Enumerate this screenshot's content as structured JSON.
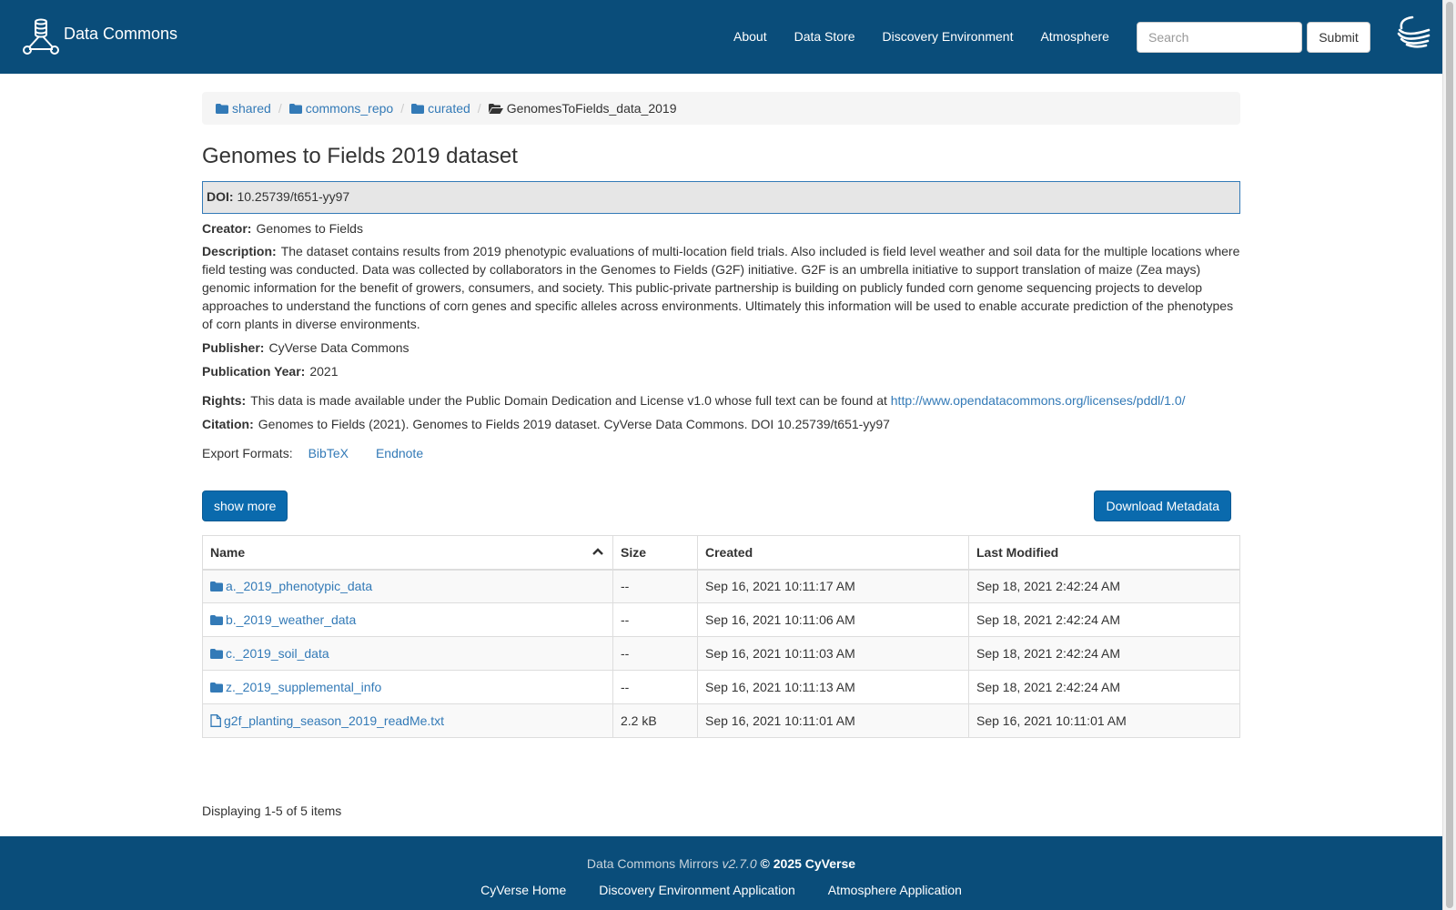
{
  "header": {
    "brand_name": "Data Commons",
    "nav": [
      "About",
      "Data Store",
      "Discovery Environment",
      "Atmosphere"
    ],
    "search_placeholder": "Search",
    "submit_label": "Submit"
  },
  "breadcrumb": [
    "shared",
    "commons_repo",
    "curated",
    "GenomesToFields_data_2019"
  ],
  "dataset": {
    "title": "Genomes to Fields 2019 dataset",
    "doi_label": "DOI:",
    "doi": "10.25739/t651-yy97",
    "creator_label": "Creator:",
    "creator": "Genomes to Fields",
    "description_label": "Description:",
    "description": "The dataset contains results from 2019 phenotypic evaluations of multi-location field trials. Also included is field level weather and soil data for the multiple locations where field testing was conducted. Data was collected by collaborators in the Genomes to Fields (G2F) initiative. G2F is an umbrella initiative to support translation of maize (Zea mays) genomic information for the benefit of growers, consumers, and society. This public-private partnership is building on publicly funded corn genome sequencing projects to develop approaches to understand the functions of corn genes and specific alleles across environments. Ultimately this information will be used to enable accurate prediction of the phenotypes of corn plants in diverse environments.",
    "publisher_label": "Publisher:",
    "publisher": "CyVerse Data Commons",
    "year_label": "Publication Year:",
    "year": "2021",
    "rights_label": "Rights:",
    "rights_text": "This data is made available under the Public Domain Dedication and License v1.0 whose full text can be found at",
    "rights_link": "http://www.opendatacommons.org/licenses/pddl/1.0/",
    "citation_label": "Citation:",
    "citation": "Genomes to Fields (2021). Genomes to Fields 2019 dataset. CyVerse Data Commons. DOI 10.25739/t651-yy97",
    "export_label": "Export Formats:",
    "export_formats": [
      "BibTeX",
      "Endnote"
    ]
  },
  "buttons": {
    "show_more": "show more",
    "download_metadata": "Download Metadata"
  },
  "table": {
    "headers": {
      "name": "Name",
      "size": "Size",
      "created": "Created",
      "modified": "Last Modified"
    },
    "rows": [
      {
        "type": "folder",
        "name": "a._2019_phenotypic_data",
        "size": "--",
        "created": "Sep 16, 2021 10:11:17 AM",
        "modified": "Sep 18, 2021 2:42:24 AM"
      },
      {
        "type": "folder",
        "name": "b._2019_weather_data",
        "size": "--",
        "created": "Sep 16, 2021 10:11:06 AM",
        "modified": "Sep 18, 2021 2:42:24 AM"
      },
      {
        "type": "folder",
        "name": "c._2019_soil_data",
        "size": "--",
        "created": "Sep 16, 2021 10:11:03 AM",
        "modified": "Sep 18, 2021 2:42:24 AM"
      },
      {
        "type": "folder",
        "name": "z._2019_supplemental_info",
        "size": "--",
        "created": "Sep 16, 2021 10:11:13 AM",
        "modified": "Sep 18, 2021 2:42:24 AM"
      },
      {
        "type": "file",
        "name": "g2f_planting_season_2019_readMe.txt",
        "size": "2.2 kB",
        "created": "Sep 16, 2021 10:11:01 AM",
        "modified": "Sep 16, 2021 10:11:01 AM"
      }
    ]
  },
  "pagination": "Displaying 1-5 of 5 items",
  "footer": {
    "app_name": "Data Commons Mirrors",
    "version": "v2.7.0",
    "copyright": "© 2025 CyVerse",
    "links": [
      "CyVerse Home",
      "Discovery Environment Application",
      "Atmosphere Application"
    ]
  },
  "colors": {
    "header_bg": "#0a4d7a",
    "link": "#337ab7",
    "primary_button": "#0a6aad"
  }
}
